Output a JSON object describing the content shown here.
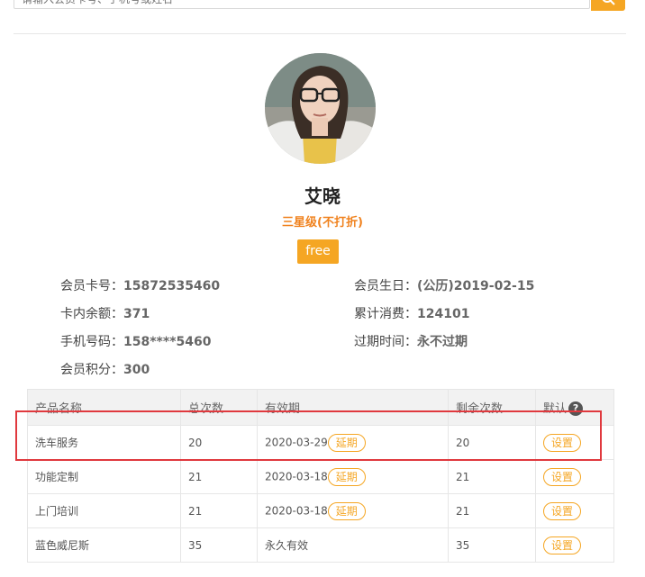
{
  "search": {
    "placeholder": "请输入会员卡号、手机号或姓名"
  },
  "member": {
    "name": "艾晓",
    "level": "三星级(不打折)",
    "badge": "free"
  },
  "info": {
    "card_label": "会员卡号：",
    "card_value": "15872535460",
    "birthday_label": "会员生日：",
    "birthday_value": "(公历)2019-02-15",
    "balance_label": "卡内余额：",
    "balance_value": "371",
    "total_label": "累计消费：",
    "total_value": "124101",
    "phone_label": "手机号码：",
    "phone_value": "158****5460",
    "expire_label": "过期时间：",
    "expire_value": "永不过期",
    "points_label": "会员积分：",
    "points_value": "300"
  },
  "table": {
    "headers": [
      "产品名称",
      "总次数",
      "有效期",
      "剩余次数",
      "默认"
    ],
    "rows": [
      {
        "product": "洗车服务",
        "total": "20",
        "expiry": "2020-03-29",
        "extend": "延期",
        "remaining": "20",
        "action": "设置"
      },
      {
        "product": "功能定制",
        "total": "21",
        "expiry": "2020-03-18",
        "extend": "延期",
        "remaining": "21",
        "action": "设置"
      },
      {
        "product": "上门培训",
        "total": "21",
        "expiry": "2020-03-18",
        "extend": "延期",
        "remaining": "21",
        "action": "设置"
      },
      {
        "product": "蓝色威尼斯",
        "total": "35",
        "expiry": "永久有效",
        "extend": "",
        "remaining": "35",
        "action": "设置"
      }
    ]
  },
  "colors": {
    "accent": "#f5a623",
    "level": "#f0821e",
    "highlight": "#e0393e"
  }
}
